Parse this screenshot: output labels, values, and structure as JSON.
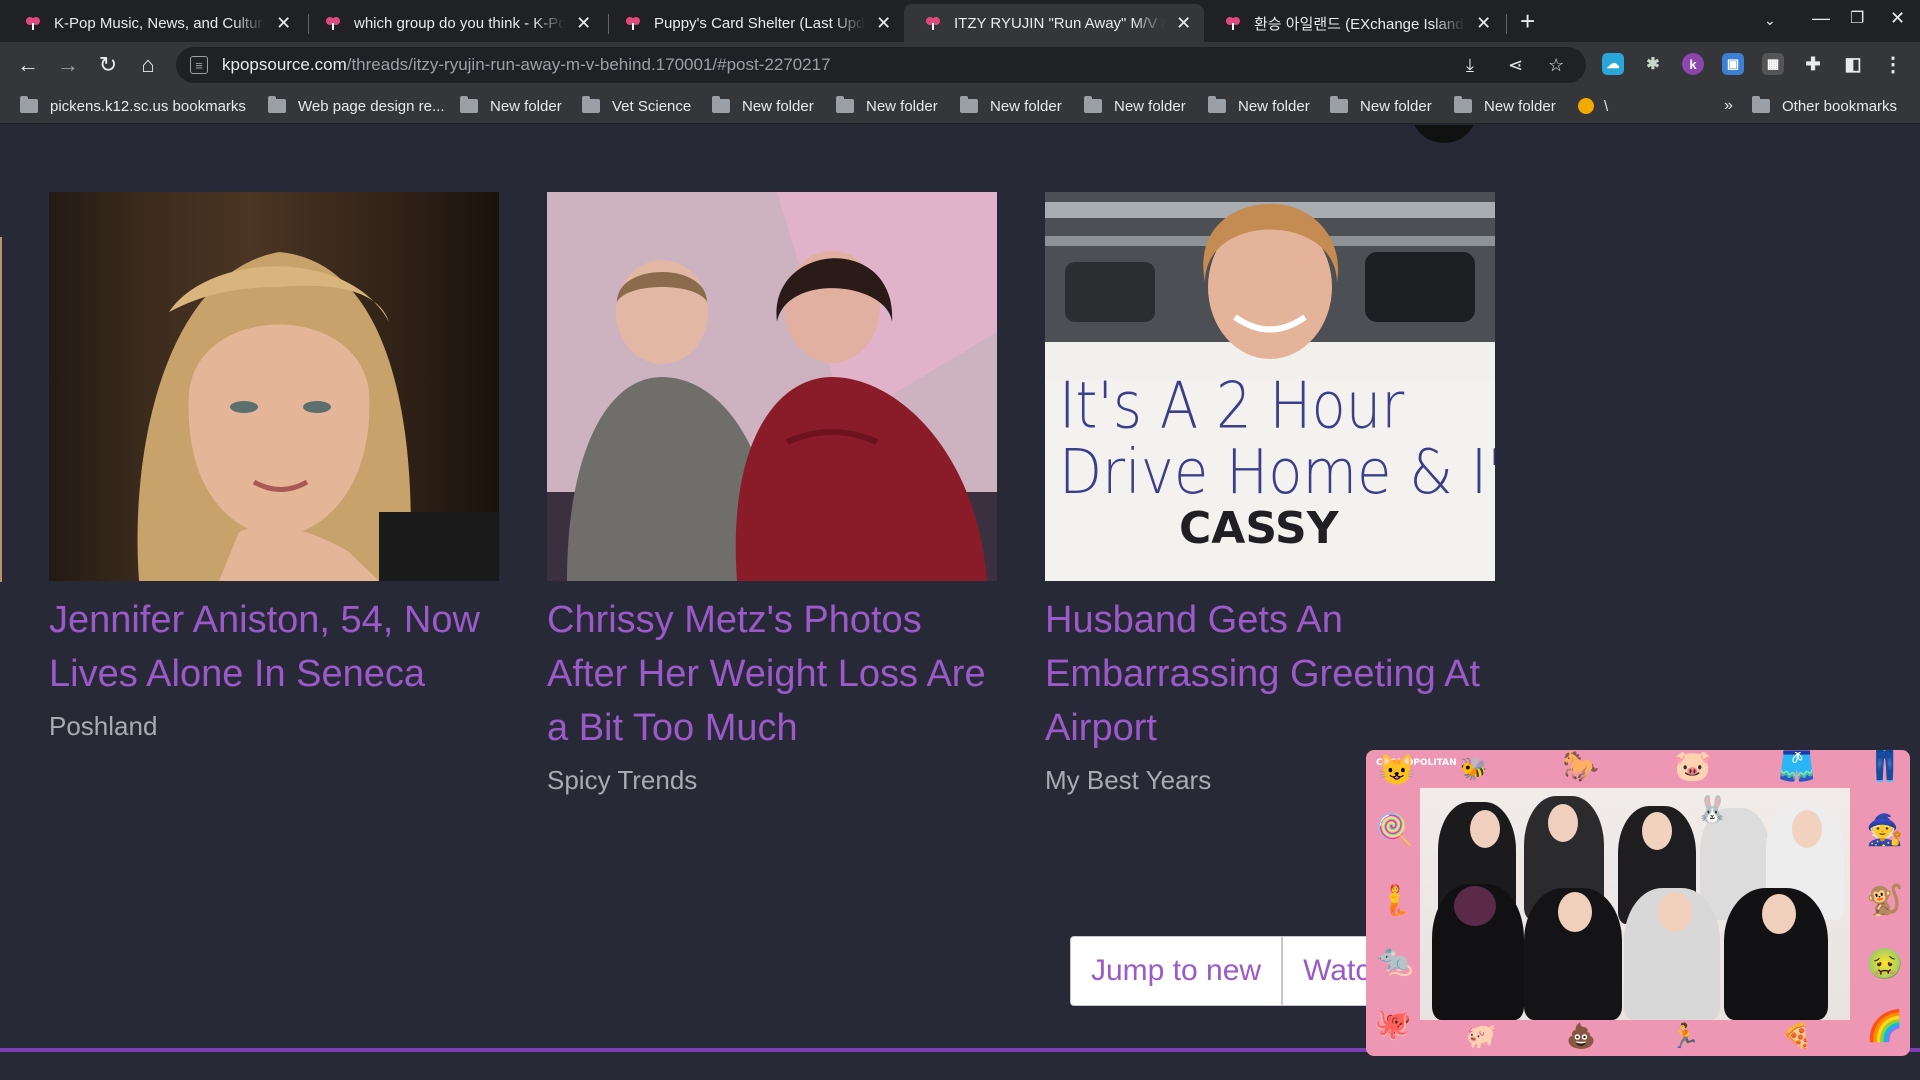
{
  "tabs": [
    {
      "title": "K-Pop Music, News, and Culture",
      "active": false
    },
    {
      "title": "which group do you think - K-Pop",
      "active": false
    },
    {
      "title": "Puppy's Card Shelter (Last Updat",
      "active": false
    },
    {
      "title": "ITZY RYUJIN \"Run Away\" M/V BE",
      "active": true
    },
    {
      "title": "환승 아일랜드 (EXchange Island)",
      "active": false
    }
  ],
  "toolbar": {
    "url_host": "kpopsource.com",
    "url_path": "/threads/itzy-ryujin-run-away-m-v-behind.170001/#post-2270217"
  },
  "bookmarks": {
    "items": [
      "pickens.k12.sc.us bookmarks",
      "Web page design re...",
      "New folder",
      "Vet Science",
      "New folder",
      "New folder",
      "New folder",
      "New folder",
      "New folder",
      "New folder",
      "New folder",
      "\\"
    ],
    "overflow": "»",
    "other": "Other bookmarks"
  },
  "cards": [
    {
      "headline": "Jennifer Aniston, 54, Now Lives Alone In Seneca",
      "source": "Poshland"
    },
    {
      "headline": "Chrissy Metz's Photos After Her Weight Loss Are a Bit Too Much",
      "source": "Spicy Trends"
    },
    {
      "headline": "Husband Gets An Embarrassing Greeting At Airport",
      "source": "My Best Years"
    }
  ],
  "sign_text": {
    "line1": "It's A 2 Hour",
    "line2": "Drive Home & I'm",
    "line3": "CASSY"
  },
  "actions": {
    "jump_label": "Jump to new",
    "watch_label": "Watc"
  },
  "pip": {
    "tag": "COSMOPOLITAN"
  },
  "colors": {
    "accent": "#9b59c9",
    "page_bg": "#272a36",
    "chrome_bg": "#35363a",
    "pip_border": "#ee97b4"
  }
}
